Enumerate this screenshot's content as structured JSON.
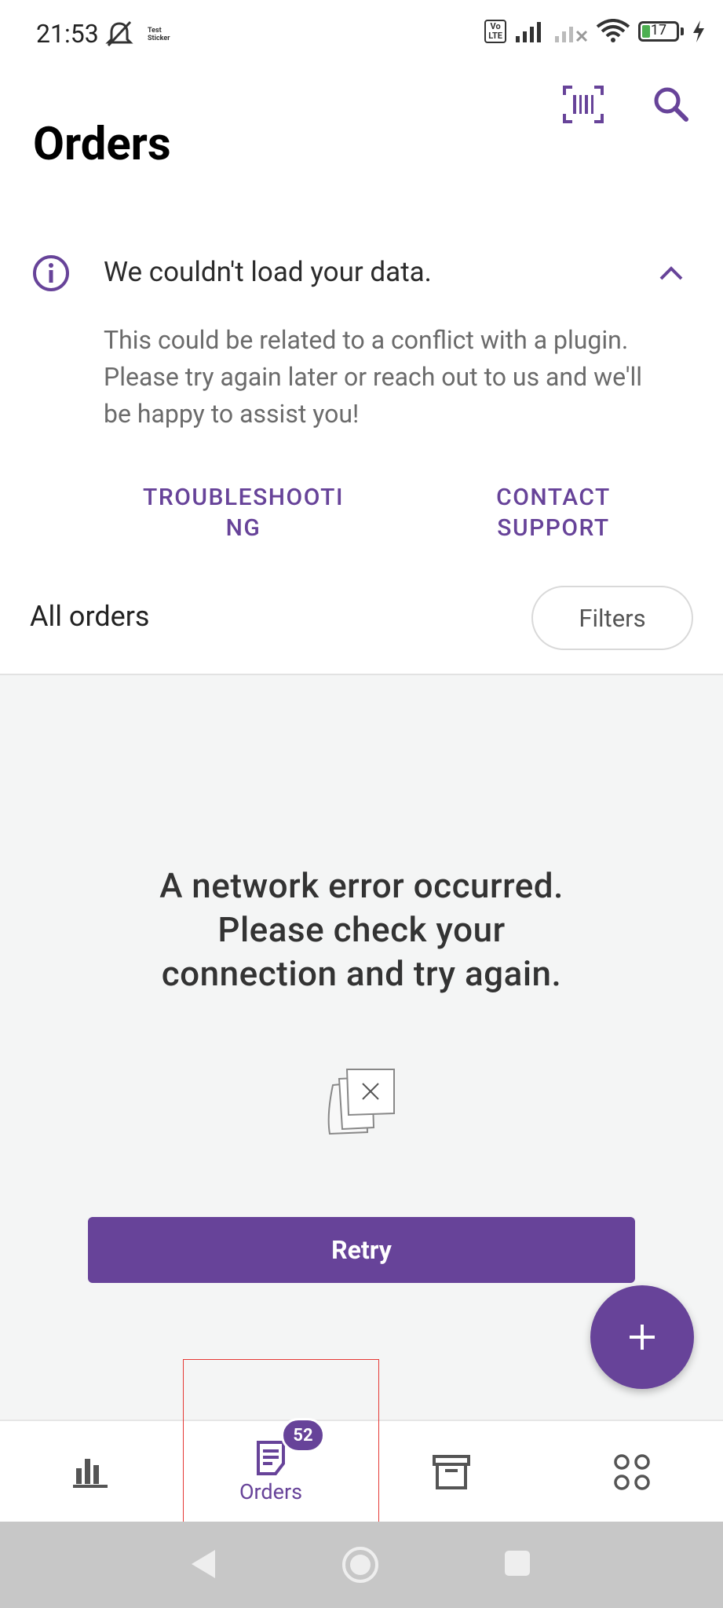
{
  "status_bar": {
    "time": "21:53",
    "sticker_line1": "Test",
    "sticker_line2": "Sticker",
    "volte_line1": "Vo",
    "volte_line2": "LTE",
    "battery_level": "17",
    "icons": [
      "mute-icon",
      "sticker-icon",
      "volte-icon",
      "signal-icon",
      "signal-off-icon",
      "wifi-icon",
      "battery-icon",
      "charging-icon"
    ]
  },
  "header": {
    "title": "Orders",
    "icons": [
      "barcode-scan-icon",
      "search-icon"
    ]
  },
  "notice": {
    "title": "We couldn't load your data.",
    "body": "This could be related to a conflict with a plugin. Please try again later or reach out to us and we'll be happy to assist you!",
    "troubleshooting_line1": "TROUBLESHOOTI",
    "troubleshooting_line2": "NG",
    "contact_line1": "CONTACT",
    "contact_line2": "SUPPORT"
  },
  "list_header": {
    "title": "All orders",
    "filters_label": "Filters"
  },
  "error": {
    "message_line1": "A network error occurred.",
    "message_line2": "Please check your",
    "message_line3": "connection and try again.",
    "retry_label": "Retry"
  },
  "bottom_nav": {
    "items": [
      {
        "name": "stats",
        "label": "",
        "icon": "bar-chart-icon"
      },
      {
        "name": "orders",
        "label": "Orders",
        "icon": "orders-icon",
        "badge": "52",
        "active": true
      },
      {
        "name": "products",
        "label": "",
        "icon": "archive-box-icon"
      },
      {
        "name": "more",
        "label": "",
        "icon": "grid-dots-icon"
      }
    ]
  },
  "colors": {
    "accent": "#674399",
    "content_bg": "#f4f5f5",
    "system_nav_bg": "#c7c7c7"
  }
}
